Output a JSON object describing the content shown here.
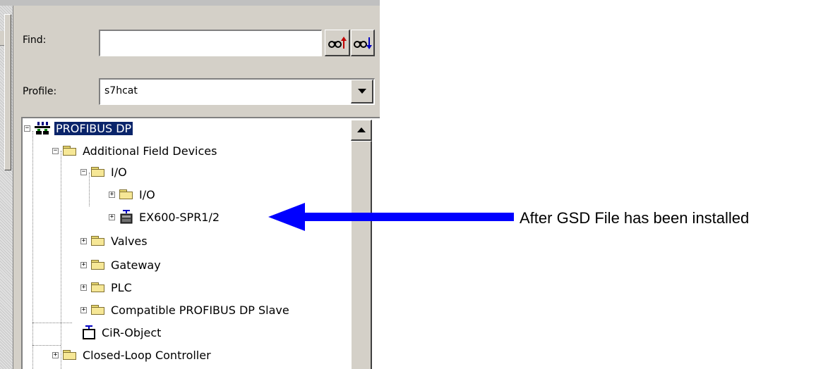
{
  "find": {
    "label": "Find:",
    "value": ""
  },
  "profile": {
    "label": "Profile:",
    "value": "s7hcat"
  },
  "tree": {
    "root": "PROFIBUS DP",
    "additional_field_devices": "Additional Field Devices",
    "io_group": "I/O",
    "io_sub": "I/O",
    "ex600": "EX600-SPR1/2",
    "valves": "Valves",
    "gateway": "Gateway",
    "plc": "PLC",
    "compatible": "Compatible PROFIBUS DP Slave",
    "cir_object": "CiR-Object",
    "closed_loop": "Closed-Loop Controller"
  },
  "annotation": "After GSD File has been installed",
  "colors": {
    "selection": "#0a246a",
    "arrow": "#0000ff",
    "folder": "#f6e796",
    "panel": "#d4d0c8"
  },
  "icons": [
    "find-up-icon",
    "find-down-icon",
    "dropdown-arrow-icon",
    "network-icon",
    "folder-icon",
    "device-icon",
    "cir-object-icon",
    "expand-icon",
    "collapse-icon",
    "scroll-up-icon",
    "arrow-icon"
  ]
}
